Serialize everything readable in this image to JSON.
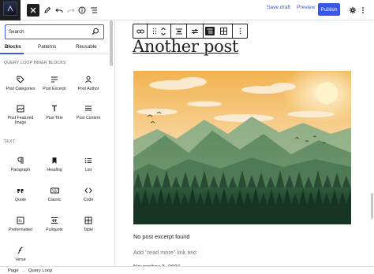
{
  "toolbar": {
    "save_draft": "Save draft",
    "preview": "Preview",
    "publish": "Publish",
    "icons": [
      "site-logo",
      "close-icon",
      "pencil-icon",
      "undo-icon",
      "redo-icon",
      "info-icon",
      "list-view-icon",
      "settings-gear-icon",
      "more-vertical-icon"
    ]
  },
  "inserter": {
    "search_placeholder": "Search",
    "tabs": [
      "Blocks",
      "Patterns",
      "Reusable"
    ],
    "active_tab": "Blocks",
    "sections": [
      {
        "title": "QUERY LOOP INNER BLOCKS",
        "items": [
          {
            "label": "Post Categories",
            "icon": "tag-icon"
          },
          {
            "label": "Post Excerpt",
            "icon": "excerpt-icon"
          },
          {
            "label": "Post Author",
            "icon": "author-icon"
          },
          {
            "label": "Post Featured Image",
            "icon": "featured-image-icon"
          },
          {
            "label": "Post Title",
            "icon": "title-icon"
          },
          {
            "label": "Post Content",
            "icon": "content-icon"
          }
        ]
      },
      {
        "title": "TEXT",
        "items": [
          {
            "label": "Paragraph",
            "icon": "paragraph-icon"
          },
          {
            "label": "Heading",
            "icon": "heading-icon"
          },
          {
            "label": "List",
            "icon": "list-icon"
          },
          {
            "label": "Quote",
            "icon": "quote-icon"
          },
          {
            "label": "Classic",
            "icon": "keyboard-icon"
          },
          {
            "label": "Code",
            "icon": "code-icon"
          },
          {
            "label": "Preformatted",
            "icon": "preformatted-icon"
          },
          {
            "label": "Pullquote",
            "icon": "pullquote-icon"
          },
          {
            "label": "Table",
            "icon": "table-icon"
          },
          {
            "label": "Verse",
            "icon": "verse-icon"
          }
        ]
      }
    ]
  },
  "editor": {
    "post_title": "Another post",
    "excerpt": "No post excerpt found",
    "read_more_placeholder": "Add \"read more\" link text",
    "date": "November 3, 2021",
    "block_toolbar_icons": [
      "link-icon",
      "drag-handle-icon",
      "move-up-icon",
      "move-down-icon",
      "align-icon",
      "settings-sliders-icon",
      "list-view-block-icon",
      "grid-view-icon",
      "more-options-icon"
    ]
  },
  "breadcrumb": {
    "items": [
      "Page",
      "Query Loop"
    ],
    "separator": "→"
  },
  "colors": {
    "accent": "#3858e9",
    "dark": "#1e1e1e",
    "muted": "#757575"
  }
}
